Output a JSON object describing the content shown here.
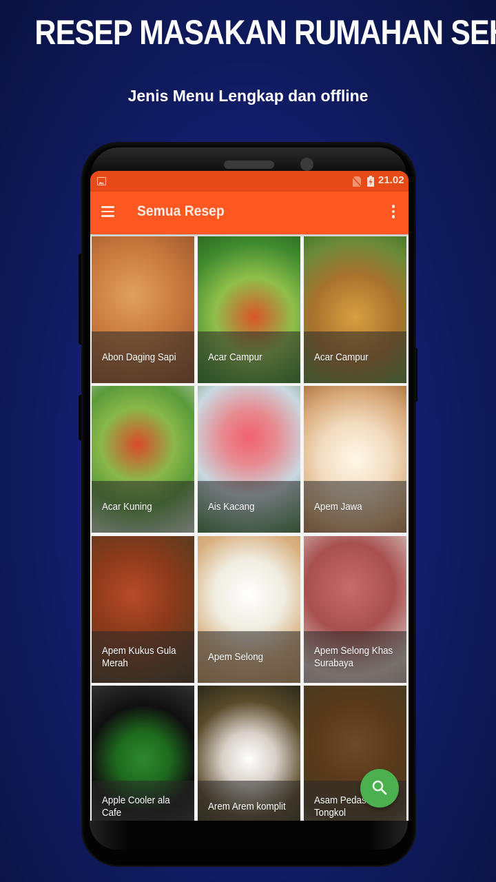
{
  "promo": {
    "headline": "RESEP MASAKAN RUMAHAN SEHARI HARI",
    "subtitle": "Jenis Menu Lengkap dan offline"
  },
  "status_bar": {
    "left_icon": "image-notification-icon",
    "icons": [
      "no-sim-icon",
      "battery-charging-icon"
    ],
    "time": "21.02"
  },
  "app_bar": {
    "menu_icon": "hamburger-menu-icon",
    "title": "Semua Resep",
    "overflow_icon": "more-vertical-icon",
    "color": "#fe5722"
  },
  "recipes": [
    {
      "title": "Abon Daging Sapi",
      "lines": [
        "Abon Daging Sapi"
      ]
    },
    {
      "title": "Acar Campur",
      "lines": [
        "Acar Campur"
      ]
    },
    {
      "title": "Acar Campur",
      "lines": [
        "Acar Campur"
      ]
    },
    {
      "title": "Acar Kuning",
      "lines": [
        "Acar Kuning"
      ]
    },
    {
      "title": "Ais Kacang",
      "lines": [
        "Ais Kacang"
      ]
    },
    {
      "title": "Apem Jawa",
      "lines": [
        "Apem Jawa"
      ]
    },
    {
      "title": "Apem Kukus Gula Merah",
      "lines": [
        "Apem Kukus Gula",
        "Merah"
      ]
    },
    {
      "title": "Apem Selong",
      "lines": [
        "Apem Selong"
      ]
    },
    {
      "title": "Apem Selong Khas Surabaya",
      "lines": [
        "Apem Selong Khas",
        "Surabaya"
      ]
    },
    {
      "title": "Apple Cooler ala Cafe",
      "lines": [
        "Apple Cooler ala",
        "Cafe"
      ]
    },
    {
      "title": "Arem Arem komplit",
      "lines": [
        "Arem Arem komplit"
      ]
    },
    {
      "title": "Asam Pedas ... Tongkol",
      "lines": [
        "Asam Pedas",
        "Tongkol"
      ]
    }
  ],
  "fab": {
    "icon": "search-icon",
    "color": "#4caf50"
  }
}
